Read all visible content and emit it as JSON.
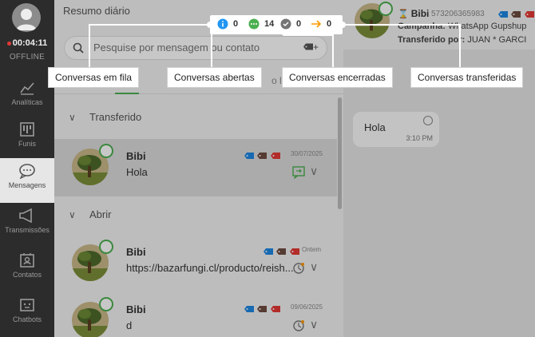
{
  "sidebar": {
    "timer": "00:04:11",
    "status": "OFFLINE",
    "items": [
      {
        "label": "Analíticas",
        "icon": "analytics-icon"
      },
      {
        "label": "Funis",
        "icon": "funnel-icon"
      },
      {
        "label": "Mensagens",
        "icon": "messages-icon"
      },
      {
        "label": "Transmissões",
        "icon": "broadcast-icon"
      },
      {
        "label": "Contatos",
        "icon": "contacts-icon"
      },
      {
        "label": "Chatbots",
        "icon": "chatbot-icon"
      }
    ]
  },
  "panel": {
    "title": "Resumo diário",
    "search_placeholder": "Pesquise por mensagem ou contato",
    "tabs": [
      "r",
      "o lido"
    ],
    "sections": [
      "Transferido",
      "Abrir"
    ],
    "conversations": [
      {
        "name": "Bibi",
        "message": "Hola",
        "date": "30/07/2025"
      },
      {
        "name": "Bibi",
        "message": "https://bazarfungi.cl/producto/reish...",
        "date": "Ontem"
      },
      {
        "name": "Bibi",
        "message": "d",
        "date": "09/06/2025"
      }
    ]
  },
  "summary": {
    "queue": "0",
    "open": "14",
    "closed": "0",
    "transferred": "0"
  },
  "labels": {
    "queue": "Conversas em fila",
    "open": "Conversas abertas",
    "closed": "Conversas encerradas",
    "transferred": "Conversas transferidas"
  },
  "chat": {
    "name": "Bibi",
    "phone": "573206365983",
    "campaign_label": "Campanha:",
    "campaign_value": "WhatsApp Gupshup",
    "transferred_label": "Transferido por:",
    "transferred_value": "JUAN * GARCI",
    "message": "Hola",
    "time": "3:10 PM"
  },
  "colors": {
    "accent": "#4caf50",
    "sidebar": "#2c2c2c",
    "info": "#2196f3",
    "open": "#4caf50",
    "closed": "#757575",
    "transfer": "#ff9800"
  }
}
